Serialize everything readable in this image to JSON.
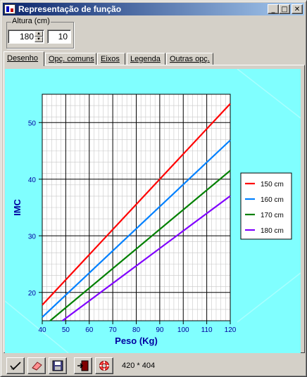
{
  "window": {
    "title": "Representação de função"
  },
  "titlebar_buttons": {
    "minimize": "_",
    "maximize": "□",
    "close": "✕"
  },
  "height_group": {
    "label": "Altura (cm)",
    "spin_value": "180",
    "step_value": "10"
  },
  "tabs": [
    {
      "label": "Desenho",
      "active": true
    },
    {
      "label": "Opç. comuns",
      "active": false
    },
    {
      "label": "Eixos",
      "active": false
    },
    {
      "label": "Legenda",
      "active": false
    },
    {
      "label": "Outras opç.",
      "active": false
    }
  ],
  "toolbar": {
    "icons": [
      "draw-check-icon",
      "eraser-icon",
      "save-disk-icon",
      "exit-door-icon",
      "lifebuoy-icon"
    ],
    "size_label": "420 * 404"
  },
  "colors": {
    "plot_background": "#80ffff",
    "axis_text": "#0000a0",
    "grid": "#000000"
  },
  "chart_data": {
    "type": "line",
    "xlabel": "Peso (Kg)",
    "ylabel": "IMC",
    "xlim": [
      40,
      120
    ],
    "ylim": [
      15,
      55
    ],
    "x_ticks": [
      40,
      50,
      60,
      70,
      80,
      90,
      100,
      110,
      120
    ],
    "y_ticks": [
      20,
      30,
      40,
      50
    ],
    "grid": true,
    "legend_position": "right",
    "series": [
      {
        "name": "150 cm",
        "color": "#ff0000",
        "height_m": 1.5,
        "x": [
          40,
          120
        ],
        "y": [
          17.78,
          53.33
        ]
      },
      {
        "name": "160 cm",
        "color": "#0080ff",
        "height_m": 1.6,
        "x": [
          40,
          120
        ],
        "y": [
          15.63,
          46.88
        ]
      },
      {
        "name": "170 cm",
        "color": "#008000",
        "height_m": 1.7,
        "x": [
          43.35,
          120
        ],
        "y": [
          15.0,
          41.52
        ]
      },
      {
        "name": "180 cm",
        "color": "#8000ff",
        "height_m": 1.8,
        "x": [
          48.6,
          120
        ],
        "y": [
          15.0,
          37.04
        ]
      }
    ]
  }
}
